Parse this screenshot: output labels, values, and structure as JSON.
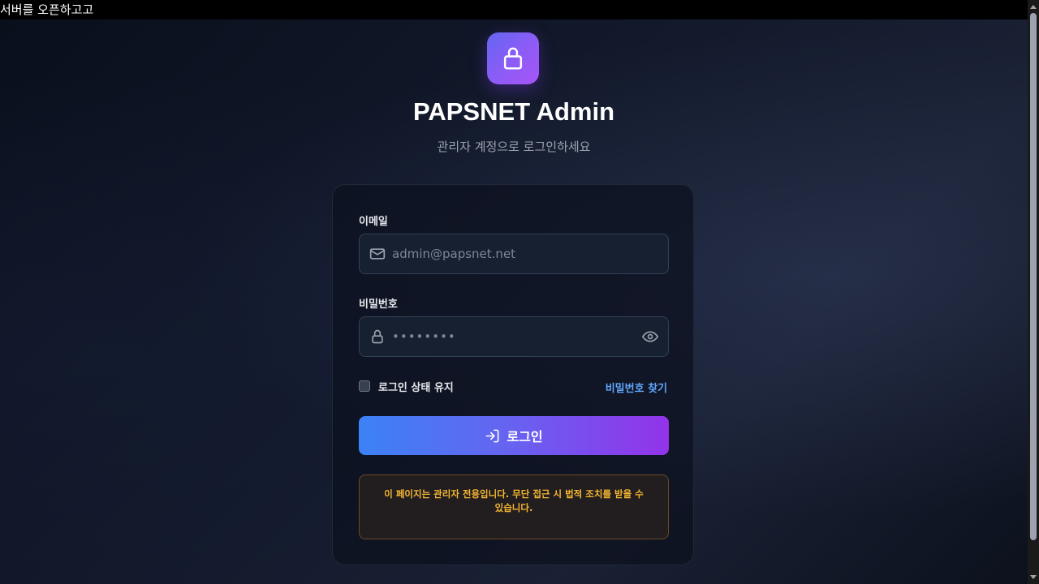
{
  "window": {
    "title": "서버를 오픈하고고"
  },
  "header": {
    "logo_icon": "lock-icon",
    "title": "PAPSNET Admin",
    "subtitle": "관리자 계정으로 로그인하세요"
  },
  "form": {
    "email_label": "이메일",
    "email_placeholder": "admin@papsnet.net",
    "email_icon": "mail-icon",
    "password_label": "비밀번호",
    "password_placeholder": "••••••••",
    "password_icon": "lock-icon",
    "password_toggle_icon": "eye-icon",
    "remember_label": "로그인 상태 유지",
    "remember_checked": false,
    "forgot_link": "비밀번호 찾기",
    "login_button": "로그인",
    "login_icon": "login-arrow-icon"
  },
  "notice": {
    "text": "이 페이지는 관리자 전용입니다. 무단 접근 시 법적 조치를 받을 수 있습니다."
  },
  "colors": {
    "accent_blue": "#3b82f6",
    "accent_purple": "#9333ea",
    "link": "#60a5fa",
    "warning_text": "#f5b731"
  }
}
